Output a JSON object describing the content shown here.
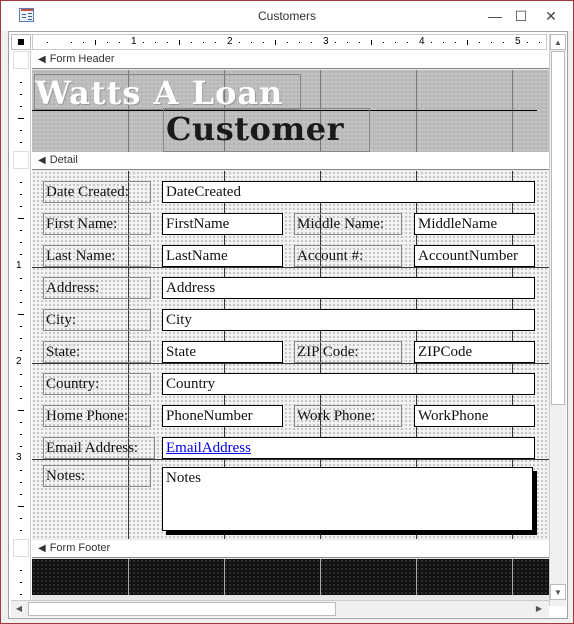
{
  "window": {
    "title": "Customers",
    "controls": {
      "minimize": "—",
      "maximize": "☐",
      "close": "✕"
    }
  },
  "rulers": {
    "horizontal_labels": [
      "1",
      "2",
      "3",
      "4",
      "5"
    ],
    "vertical_labels": [
      "1",
      "2",
      "3"
    ]
  },
  "sections": {
    "header": "Form Header",
    "detail": "Detail",
    "footer": "Form Footer",
    "arrow_icon": "section-collapse-arrow"
  },
  "header": {
    "brand": "Watts A Loan",
    "heading": "Customer"
  },
  "detail": {
    "labels": {
      "date_created": "Date Created:",
      "first_name": "First Name:",
      "middle_name": "Middle Name:",
      "last_name": "Last Name:",
      "account": "Account #:",
      "address": "Address:",
      "city": "City:",
      "state": "State:",
      "zip": "ZIP Code:",
      "country": "Country:",
      "home_phone": "Home Phone:",
      "work_phone": "Work Phone:",
      "email": "Email Address:",
      "notes": "Notes:"
    },
    "fields": {
      "date_created": "DateCreated",
      "first_name": "FirstName",
      "middle_name": "MiddleName",
      "last_name": "LastName",
      "account": "AccountNumber",
      "address": "Address",
      "city": "City",
      "state": "State",
      "zip": "ZIPCode",
      "country": "Country",
      "home_phone": "PhoneNumber",
      "work_phone": "WorkPhone",
      "email": "EmailAddress",
      "notes": "Notes"
    }
  },
  "colors": {
    "window_border": "#a4373a",
    "header_background": "#c0c0c0",
    "footer_background": "#111111",
    "link": "#0000ee"
  }
}
